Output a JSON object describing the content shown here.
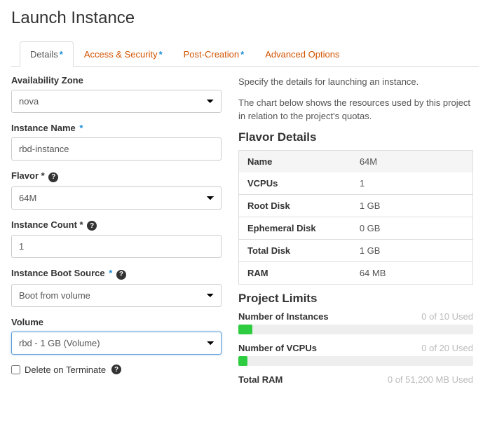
{
  "page_title": "Launch Instance",
  "tabs": [
    {
      "label": "Details",
      "required": true,
      "active": true
    },
    {
      "label": "Access & Security",
      "required": true,
      "active": false
    },
    {
      "label": "Post-Creation",
      "required": true,
      "active": false
    },
    {
      "label": "Advanced Options",
      "required": false,
      "active": false
    }
  ],
  "form": {
    "availability_zone": {
      "label": "Availability Zone",
      "value": "nova"
    },
    "instance_name": {
      "label": "Instance Name",
      "value": "rbd-instance",
      "required": true
    },
    "flavor": {
      "label": "Flavor",
      "value": "64M",
      "required": true,
      "help": true
    },
    "instance_count": {
      "label": "Instance Count",
      "value": "1",
      "required": true,
      "help": true
    },
    "boot_source": {
      "label": "Instance Boot Source",
      "value": "Boot from volume",
      "required": true,
      "help": true
    },
    "volume": {
      "label": "Volume",
      "value": "rbd - 1 GB (Volume)"
    },
    "delete_on_terminate": {
      "label": "Delete on Terminate",
      "checked": false,
      "help": true
    }
  },
  "help": {
    "line1": "Specify the details for launching an instance.",
    "line2": "The chart below shows the resources used by this project in relation to the project's quotas."
  },
  "flavor_details": {
    "title": "Flavor Details",
    "rows": [
      {
        "k": "Name",
        "v": "64M"
      },
      {
        "k": "VCPUs",
        "v": "1"
      },
      {
        "k": "Root Disk",
        "v": "1 GB"
      },
      {
        "k": "Ephemeral Disk",
        "v": "0 GB"
      },
      {
        "k": "Total Disk",
        "v": "1 GB"
      },
      {
        "k": "RAM",
        "v": "64 MB"
      }
    ]
  },
  "project_limits": {
    "title": "Project Limits",
    "items": [
      {
        "title": "Number of Instances",
        "used_text": "0 of 10 Used",
        "percent": 6
      },
      {
        "title": "Number of VCPUs",
        "used_text": "0 of 20 Used",
        "percent": 4
      },
      {
        "title": "Total RAM",
        "used_text": "0 of 51,200 MB Used",
        "percent": 0
      }
    ]
  },
  "chart_data": [
    {
      "type": "bar",
      "title": "Number of Instances",
      "categories": [
        "Used"
      ],
      "values": [
        0
      ],
      "ylim": [
        0,
        10
      ],
      "ylabel": "Instances"
    },
    {
      "type": "bar",
      "title": "Number of VCPUs",
      "categories": [
        "Used"
      ],
      "values": [
        0
      ],
      "ylim": [
        0,
        20
      ],
      "ylabel": "VCPUs"
    },
    {
      "type": "bar",
      "title": "Total RAM",
      "categories": [
        "Used"
      ],
      "values": [
        0
      ],
      "ylim": [
        0,
        51200
      ],
      "ylabel": "MB"
    }
  ]
}
